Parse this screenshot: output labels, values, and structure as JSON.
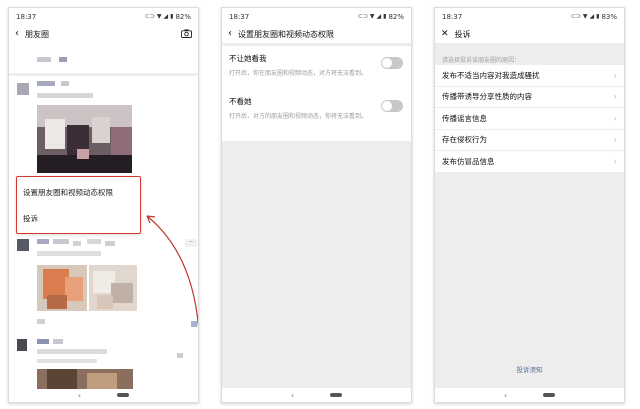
{
  "screens": [
    {
      "status": {
        "time": "18:37",
        "battery": "82%"
      },
      "title": "朋友圈",
      "menu": {
        "items": [
          "设置朋友圈和视频动态权限",
          "投诉"
        ]
      }
    },
    {
      "status": {
        "time": "18:37",
        "battery": "82%"
      },
      "title": "设置朋友圈和视频动态权限",
      "settings": [
        {
          "label": "不让她看我",
          "desc": "打开后，你在朋友圈和视频动态，对方将无法看到。",
          "enabled": false
        },
        {
          "label": "不看她",
          "desc": "打开后，对方的朋友圈和视频动态，你将无法看到。",
          "enabled": false
        }
      ]
    },
    {
      "status": {
        "time": "18:37",
        "battery": "83%"
      },
      "title": "投诉",
      "hint": "请选择投诉该朋友圈的原因：",
      "reasons": [
        "发布不适当内容对我造成骚扰",
        "传播带诱导分享性质的内容",
        "传播谣言信息",
        "存在侵权行为",
        "发布仿冒品信息"
      ],
      "footer": "投诉须知"
    }
  ],
  "icons": {
    "back": "chevron-left-icon",
    "close": "close-icon",
    "camera": "camera-icon",
    "chevron": "chevron-right-icon"
  },
  "colors": {
    "highlight_border": "#d33a2f",
    "arrow": "#c0392b",
    "link": "#576b95",
    "toggle_off": "#c8c8c8",
    "page_grey": "#ededed"
  }
}
